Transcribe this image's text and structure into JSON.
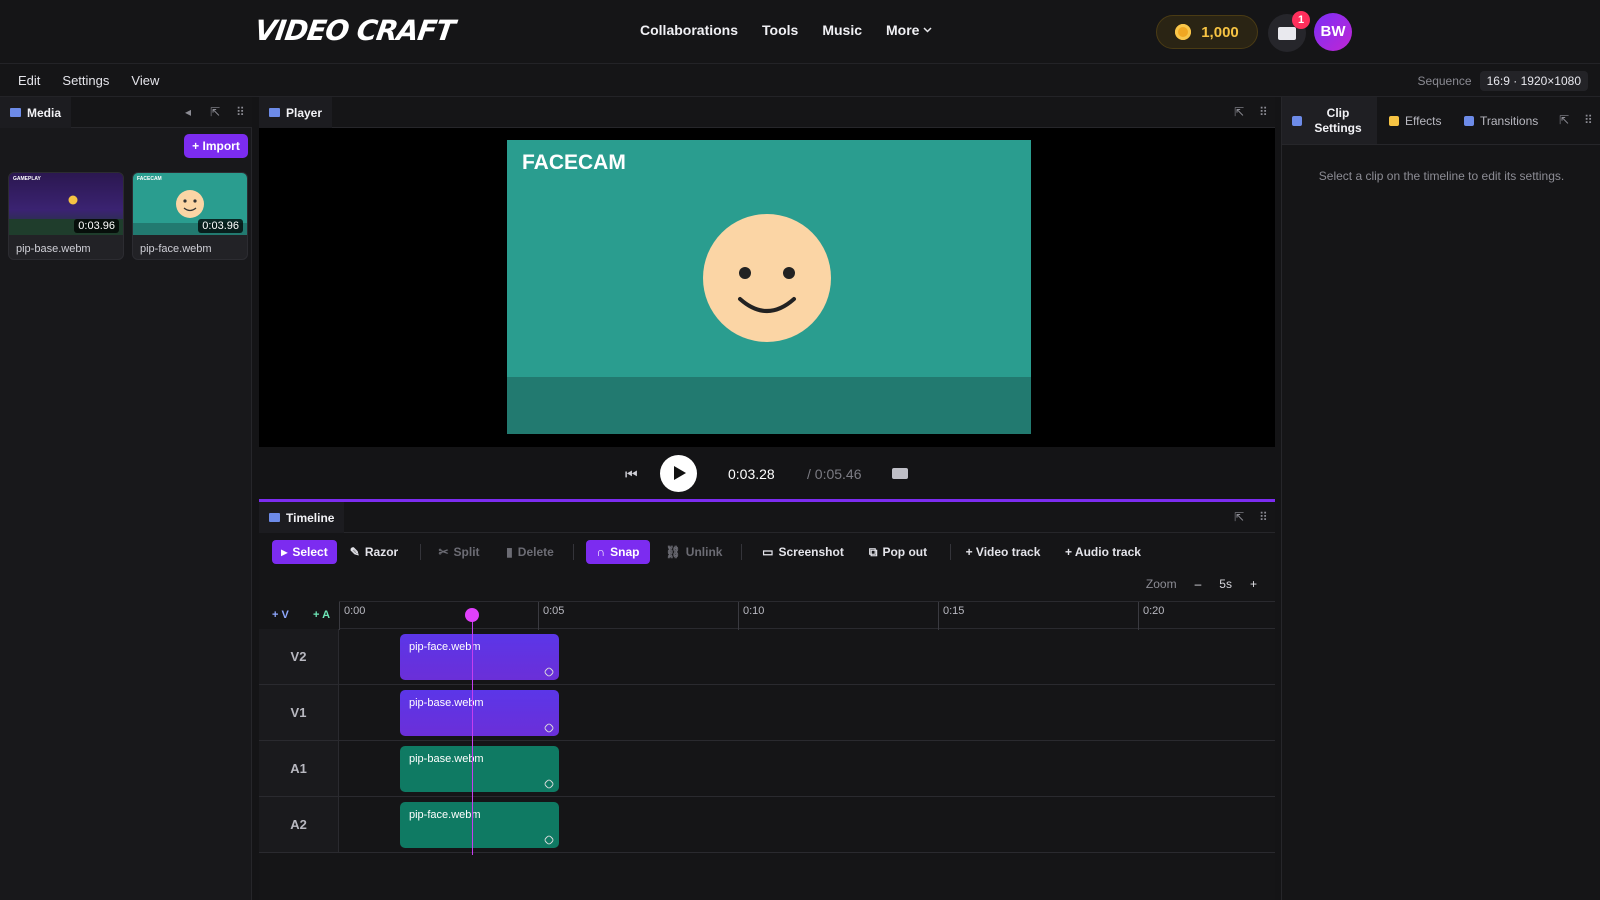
{
  "app": {
    "logo": "VIDEO CRAFT",
    "nav": [
      "Collaborations",
      "Tools",
      "Music",
      "More"
    ],
    "coins": "1,000",
    "notifications": "1",
    "avatar": "BW"
  },
  "menubar": {
    "items": [
      "Edit",
      "Settings",
      "View"
    ],
    "sequence_label": "Sequence",
    "sequence_value": "16:9 · 1920×1080"
  },
  "media": {
    "tab": "Media",
    "import_label": "+ Import",
    "items": [
      {
        "name": "pip-base.webm",
        "duration": "0:03.96",
        "tag": "GAMEPLAY"
      },
      {
        "name": "pip-face.webm",
        "duration": "0:03.96",
        "tag": "FACECAM"
      }
    ]
  },
  "player": {
    "tab": "Player",
    "frame_label": "FACECAM",
    "current_time": "0:03.28",
    "total_time": "/ 0:05.46"
  },
  "timeline": {
    "tab": "Timeline",
    "tools": {
      "select": "Select",
      "razor": "Razor",
      "split": "Split",
      "delete": "Delete",
      "snap": "Snap",
      "unlink": "Unlink",
      "screenshot": "Screenshot",
      "popout": "Pop out",
      "add_video": "+ Video track",
      "add_audio": "+ Audio track"
    },
    "zoom_label": "Zoom",
    "zoom_minus": "–",
    "zoom_value": "5s",
    "zoom_plus": "+",
    "add_v": "+ V",
    "add_a": "+ A",
    "ruler": [
      "0:00",
      "0:05",
      "0:10",
      "0:15",
      "0:20"
    ],
    "tracks": [
      {
        "label": "V2",
        "kind": "v",
        "clip": "pip-face.webm"
      },
      {
        "label": "V1",
        "kind": "v",
        "clip": "pip-base.webm"
      },
      {
        "label": "A1",
        "kind": "a",
        "clip": "pip-base.webm"
      },
      {
        "label": "A2",
        "kind": "a",
        "clip": "pip-face.webm"
      }
    ]
  },
  "inspector": {
    "tabs": [
      "Clip Settings",
      "Effects",
      "Transitions"
    ],
    "hint": "Select a clip on the timeline to edit its settings."
  },
  "colors": {
    "accent": "#7c2cf0",
    "facecam_bg": "#2a9d8f",
    "audio_clip": "#0f7a63"
  }
}
